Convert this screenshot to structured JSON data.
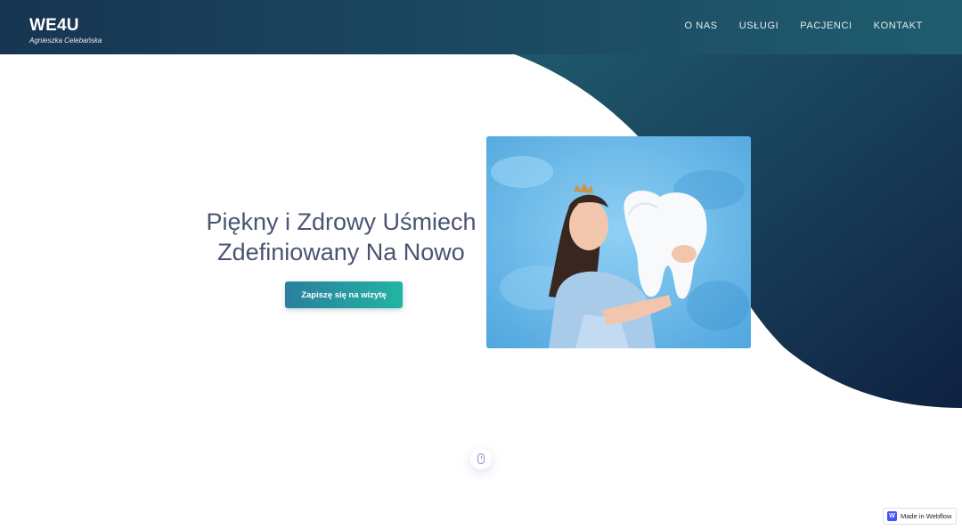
{
  "brand": {
    "title": "WE4U",
    "subtitle": "Agnieszka Celebańska"
  },
  "nav": {
    "items": [
      "O NAS",
      "USŁUGI",
      "PACJENCI",
      "KONTAKT"
    ]
  },
  "hero": {
    "title_line1": "Piękny i Zdrowy Uśmiech",
    "title_line2": "Zdefiniowany Na Nowo",
    "cta_label": "Zapiszę się na wizytę"
  },
  "badge": {
    "logo": "W",
    "text": "Made in Webflow"
  },
  "colors": {
    "header": "#173551",
    "wave_start": "#1e5a6d",
    "wave_end": "#0f2240",
    "title": "#4a5472",
    "cta_start": "#2a7f9c",
    "cta_end": "#22b4a3",
    "photo_bg": "#67b6e6"
  },
  "icons": {
    "scroll": "mouse-icon",
    "badge": "webflow-logo-icon"
  }
}
